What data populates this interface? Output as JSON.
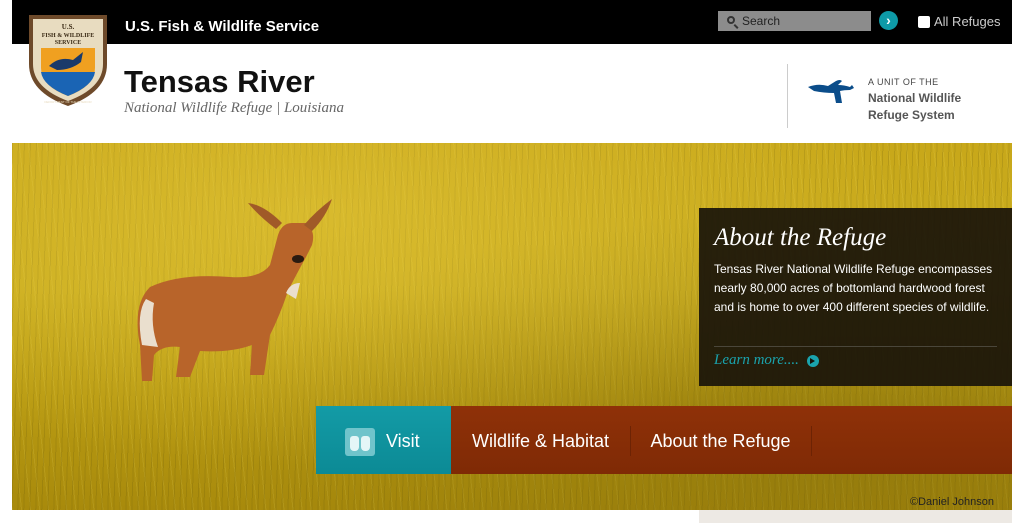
{
  "header": {
    "agency": "U.S. Fish & Wildlife Service",
    "search_placeholder": "Search",
    "all_refuges": "All Refuges"
  },
  "logo": {
    "line1": "U.S.",
    "line2": "FISH & WILDLIFE",
    "line3": "SERVICE",
    "bottom": "DEPARTMENT OF THE INTERIOR"
  },
  "site": {
    "title": "Tensas River",
    "subtitle": "National Wildlife Refuge | Louisiana"
  },
  "nwrs": {
    "line1": "A UNIT OF THE",
    "line2": "National Wildlife",
    "line3": "Refuge System"
  },
  "about": {
    "title": "About the Refuge",
    "text": "Tensas River National Wildlife Refuge encompasses nearly 80,000 acres of bottomland hardwood forest and is home to over 400 different species of wildlife.",
    "link": "Learn more...."
  },
  "nav": {
    "items": [
      {
        "label": "Visit"
      },
      {
        "label": "Wildlife & Habitat"
      },
      {
        "label": "About the Refuge"
      }
    ]
  },
  "photo_credit": "©Daniel Johnson",
  "colors": {
    "accent": "#0e9aa7",
    "nav": "#8f3108",
    "topbar": "#000000"
  }
}
